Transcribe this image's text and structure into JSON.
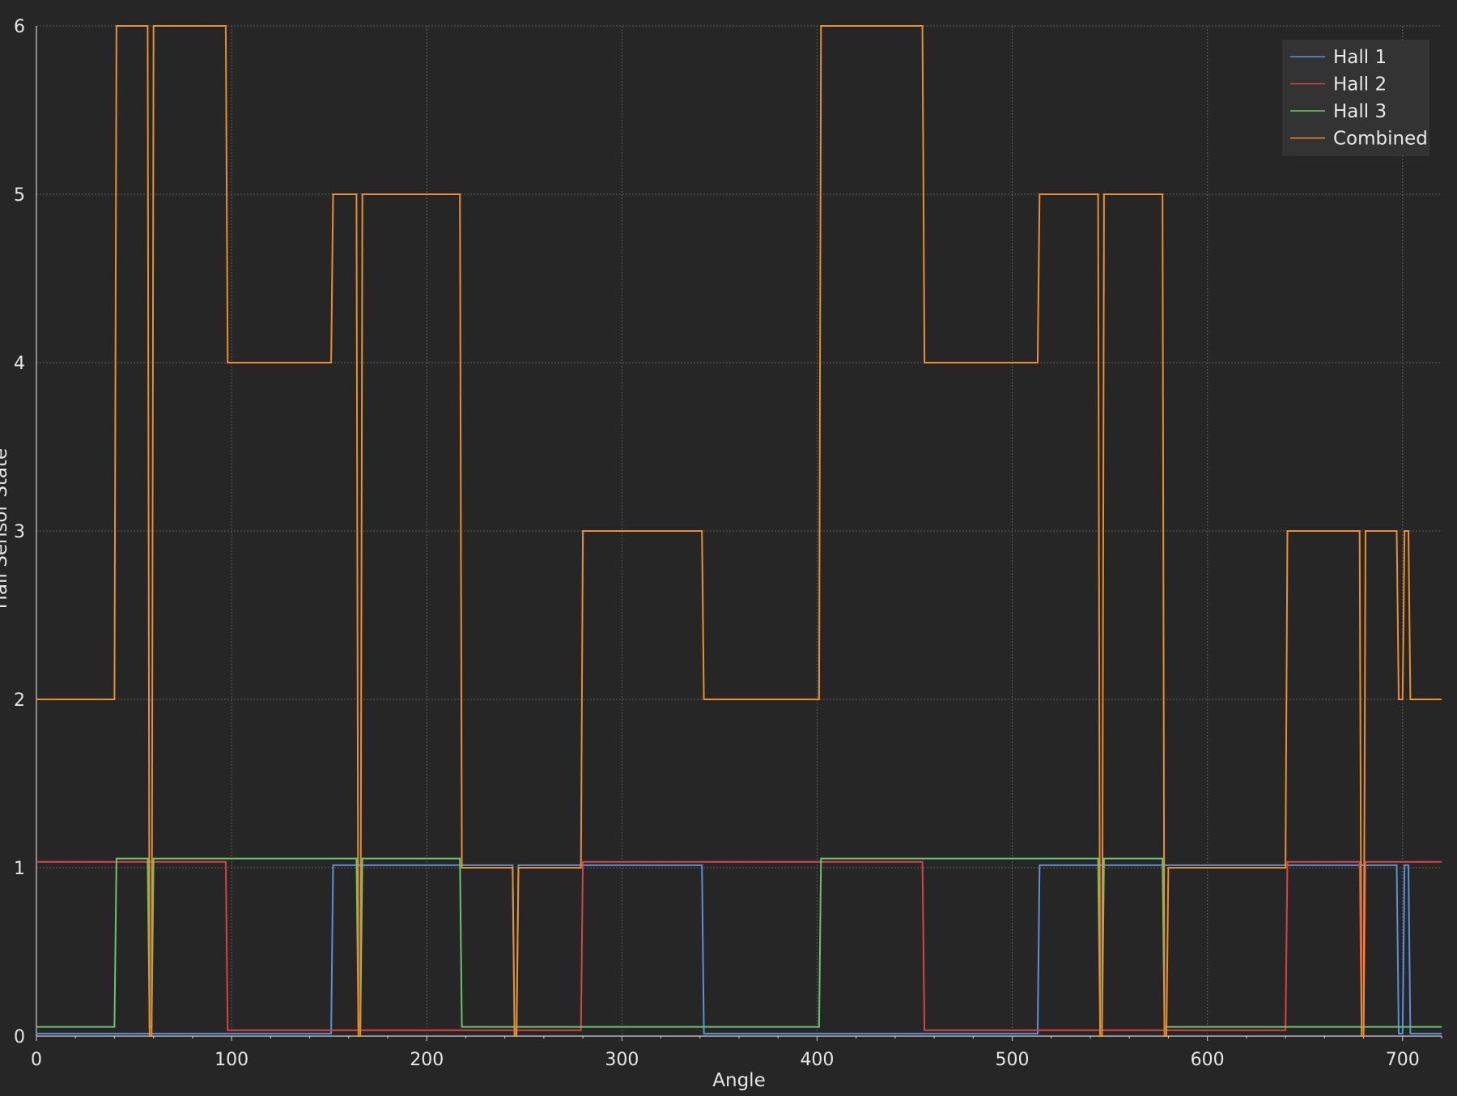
{
  "chart_data": {
    "type": "line",
    "title": "",
    "xlabel": "Angle",
    "ylabel": "Hall Sensor State",
    "xlim": [
      0,
      720
    ],
    "ylim": [
      0,
      6
    ],
    "xticks": [
      0,
      100,
      200,
      300,
      400,
      500,
      600,
      700
    ],
    "yticks": [
      0,
      1,
      2,
      3,
      4,
      5,
      6
    ],
    "grid": true,
    "legend_position": "top-right",
    "background": "#262626",
    "series": [
      {
        "name": "Hall 1",
        "color": "#5b8fd6",
        "offset": 0.015,
        "x": [
          0,
          151,
          152,
          164,
          165,
          217,
          218,
          244,
          245,
          246,
          247,
          280,
          281,
          341,
          342,
          513,
          514,
          544,
          545,
          546,
          547,
          577,
          578,
          579,
          580,
          640,
          641,
          697,
          698,
          700,
          701,
          703,
          704,
          720
        ],
        "y": [
          0,
          0,
          1,
          1,
          1,
          1,
          1,
          1,
          0,
          0,
          1,
          1,
          1,
          1,
          0,
          0,
          1,
          1,
          1,
          1,
          1,
          1,
          1,
          1,
          1,
          1,
          1,
          1,
          0,
          0,
          1,
          1,
          0,
          0
        ]
      },
      {
        "name": "Hall 2",
        "color": "#d64545",
        "offset": 0.035,
        "x": [
          0,
          97,
          98,
          279,
          280,
          454,
          455,
          640,
          641,
          678,
          679,
          680,
          681,
          720
        ],
        "y": [
          1,
          1,
          0,
          0,
          1,
          1,
          0,
          0,
          1,
          1,
          0,
          0,
          1,
          1
        ]
      },
      {
        "name": "Hall 3",
        "color": "#6ac46a",
        "offset": 0.055,
        "x": [
          0,
          40,
          41,
          57,
          58,
          59,
          60,
          164,
          165,
          166,
          167,
          217,
          218,
          401,
          402,
          544,
          545,
          546,
          547,
          577,
          578,
          720
        ],
        "y": [
          0,
          0,
          1,
          1,
          0,
          0,
          1,
          1,
          0,
          0,
          1,
          1,
          0,
          0,
          1,
          1,
          0,
          0,
          1,
          1,
          0,
          0
        ]
      },
      {
        "name": "Combined",
        "color": "#e8902e",
        "offset": 0,
        "x": [
          0,
          40,
          41,
          57,
          58,
          59,
          60,
          97,
          98,
          151,
          152,
          164,
          165,
          166,
          167,
          217,
          218,
          244,
          245,
          246,
          247,
          279,
          280,
          341,
          342,
          401,
          402,
          454,
          455,
          513,
          514,
          544,
          545,
          546,
          547,
          577,
          578,
          579,
          580,
          640,
          641,
          678,
          679,
          680,
          681,
          697,
          698,
          700,
          701,
          703,
          704,
          720
        ],
        "y": [
          2,
          2,
          6,
          6,
          0,
          0,
          6,
          6,
          4,
          4,
          5,
          5,
          0,
          0,
          5,
          5,
          1,
          1,
          0,
          0,
          1,
          1,
          3,
          3,
          2,
          2,
          6,
          6,
          4,
          4,
          5,
          5,
          0,
          0,
          5,
          5,
          0,
          0,
          1,
          1,
          3,
          3,
          0,
          0,
          3,
          3,
          2,
          2,
          3,
          3,
          2,
          2
        ]
      }
    ]
  }
}
